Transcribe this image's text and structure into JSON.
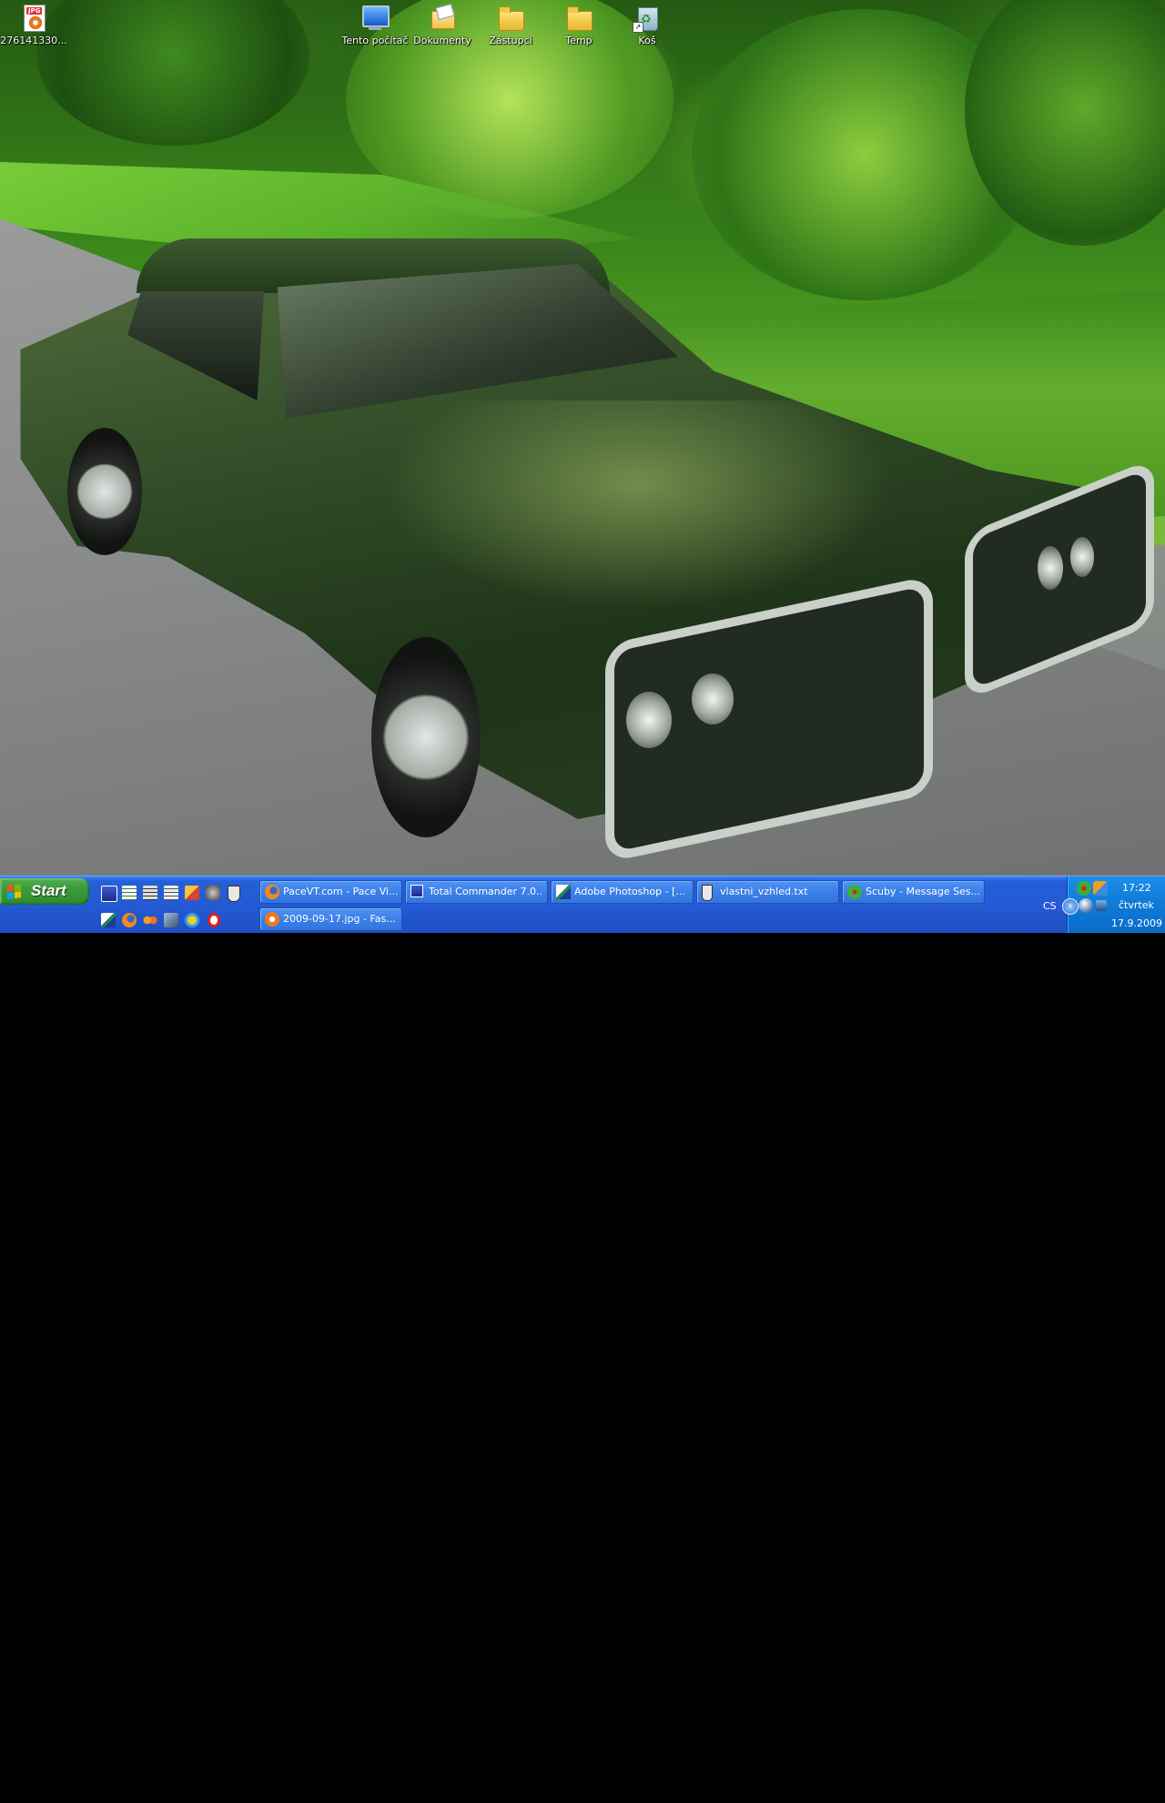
{
  "desktop": {
    "icons": [
      {
        "label": "276141330...",
        "icon": "jpg-file-icon"
      },
      {
        "label": "Tento počítač",
        "icon": "my-computer-icon"
      },
      {
        "label": "Dokumenty",
        "icon": "documents-icon"
      },
      {
        "label": "Zástupci",
        "icon": "folder-icon"
      },
      {
        "label": "Temp",
        "icon": "folder-icon"
      },
      {
        "label": "Koš",
        "icon": "recycle-bin-icon"
      }
    ]
  },
  "taskbar": {
    "start_label": "Start",
    "quick_launch": [
      {
        "icon": "save-disk-icon"
      },
      {
        "icon": "notepad-icon"
      },
      {
        "icon": "editor-icon"
      },
      {
        "icon": "document-icon"
      },
      {
        "icon": "tools-icon"
      },
      {
        "icon": "media-icon"
      },
      {
        "icon": "shield-icon"
      },
      {
        "icon": "photoshop-icon"
      },
      {
        "icon": "firefox-icon"
      },
      {
        "icon": "messenger-icon"
      },
      {
        "icon": "network-icon"
      },
      {
        "icon": "internet-explorer-icon"
      },
      {
        "icon": "opera-icon"
      }
    ],
    "tasks": [
      {
        "label": "PaceVT.com - Pace Vi...",
        "icon": "firefox-icon"
      },
      {
        "label": "Total Commander 7.0...",
        "icon": "total-commander-icon"
      },
      {
        "label": "Adobe Photoshop - [...",
        "icon": "photoshop-icon"
      },
      {
        "label": "vlastni_vzhled.txt",
        "icon": "text-file-icon"
      },
      {
        "label": "Scuby - Message Ses...",
        "icon": "icq-icon"
      },
      {
        "label": "2009-09-17.jpg - Fas...",
        "icon": "image-viewer-icon"
      }
    ],
    "language": "CS",
    "tray": {
      "time": "17:22",
      "day": "čtvrtek",
      "date": "17.9.2009"
    }
  },
  "colors": {
    "taskbar_blue": "#245ad4",
    "start_green": "#3c9a3c",
    "tray_blue": "#0f7ad8",
    "car_green": "#2f4a26"
  }
}
